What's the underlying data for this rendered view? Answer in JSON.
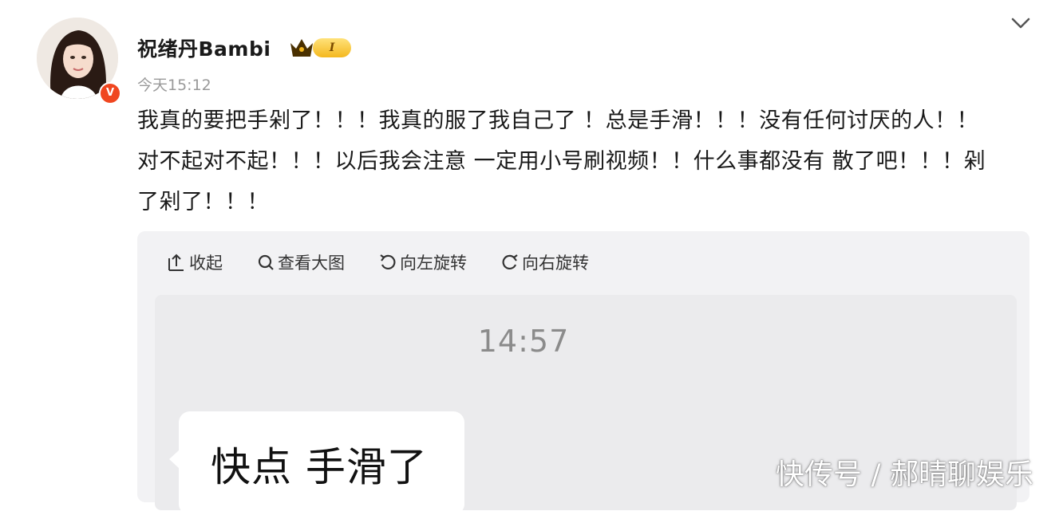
{
  "user": {
    "name": "祝绪丹Bambi",
    "timestamp": "今天15:12",
    "verified_mark": "V",
    "level_badge": "I"
  },
  "post": {
    "lines": [
      "我真的要把手剁了！！！我真的服了我自己了 ！总是手滑！！！没有任何讨厌的人！！",
      "对不起对不起！！！以后我会注意 一定用小号刷视频！！什么事都没有 散了吧！！！剁",
      "了剁了！！！"
    ]
  },
  "media_toolbar": {
    "collapse": "收起",
    "view_large": "查看大图",
    "rotate_left": "向左旋转",
    "rotate_right": "向右旋转"
  },
  "chat_screenshot": {
    "time": "14:57",
    "message": "快点 手滑了"
  },
  "watermark": "快传号 / 郝晴聊娱乐",
  "colors": {
    "verified": "#f0461f",
    "badge_gold": "#f4b81f",
    "panel_bg": "#f2f2f4"
  },
  "icons": [
    "chevron-down-icon",
    "collapse-icon",
    "zoom-icon",
    "rotate-left-icon",
    "rotate-right-icon",
    "crown-icon"
  ]
}
